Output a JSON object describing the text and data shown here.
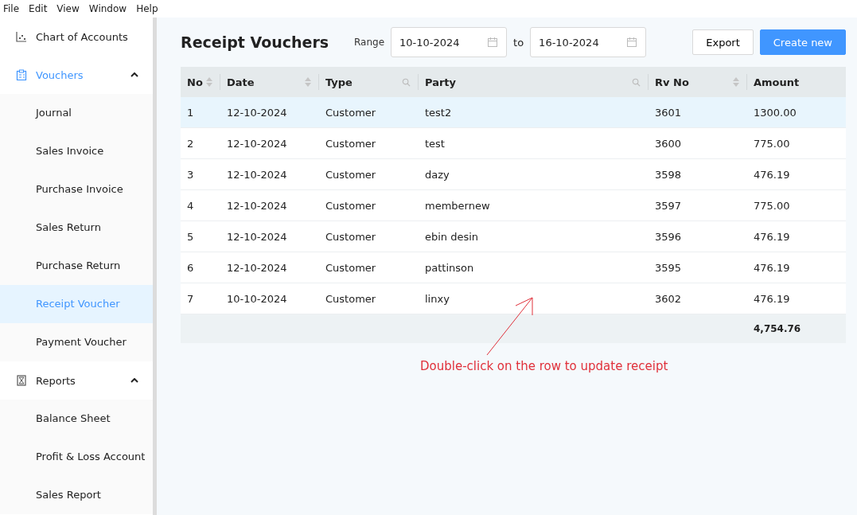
{
  "menu_bar": [
    "File",
    "Edit",
    "View",
    "Window",
    "Help"
  ],
  "sidebar": {
    "items": [
      {
        "label": "Chart of Accounts",
        "kind": "chart",
        "active": false
      },
      {
        "label": "Vouchers",
        "kind": "vouchers",
        "active": true,
        "expanded": true,
        "children": [
          {
            "label": "Journal",
            "selected": false
          },
          {
            "label": "Sales Invoice",
            "selected": false
          },
          {
            "label": "Purchase Invoice",
            "selected": false
          },
          {
            "label": "Sales Return",
            "selected": false
          },
          {
            "label": "Purchase Return",
            "selected": false
          },
          {
            "label": "Receipt Voucher",
            "selected": true
          },
          {
            "label": "Payment Voucher",
            "selected": false
          }
        ]
      },
      {
        "label": "Reports",
        "kind": "reports",
        "active": false,
        "expanded": true,
        "children": [
          {
            "label": "Balance Sheet",
            "selected": false
          },
          {
            "label": "Profit & Loss Account",
            "selected": false
          },
          {
            "label": "Sales Report",
            "selected": false
          }
        ]
      }
    ]
  },
  "page": {
    "title": "Receipt Vouchers",
    "range_label": "Range",
    "from_date": "10-10-2024",
    "to_label": "to",
    "to_date": "16-10-2024",
    "export_button": "Export",
    "create_button": "Create new"
  },
  "table": {
    "columns": [
      {
        "label": "No",
        "kind": "sortable"
      },
      {
        "label": "Date",
        "kind": "sortable"
      },
      {
        "label": "Type",
        "kind": "searchable"
      },
      {
        "label": "Party",
        "kind": "searchable"
      },
      {
        "label": "Rv No",
        "kind": "sortable"
      },
      {
        "label": "Amount",
        "kind": "plain"
      }
    ],
    "rows": [
      {
        "selected": true,
        "cells": [
          "1",
          "12-10-2024",
          "Customer",
          "test2",
          "3601",
          "1300.00"
        ]
      },
      {
        "selected": false,
        "cells": [
          "2",
          "12-10-2024",
          "Customer",
          "test",
          "3600",
          "775.00"
        ]
      },
      {
        "selected": false,
        "cells": [
          "3",
          "12-10-2024",
          "Customer",
          "dazy",
          "3598",
          "476.19"
        ]
      },
      {
        "selected": false,
        "cells": [
          "4",
          "12-10-2024",
          "Customer",
          "membernew",
          "3597",
          "775.00"
        ]
      },
      {
        "selected": false,
        "cells": [
          "5",
          "12-10-2024",
          "Customer",
          "ebin desin",
          "3596",
          "476.19"
        ]
      },
      {
        "selected": false,
        "cells": [
          "6",
          "12-10-2024",
          "Customer",
          "pattinson",
          "3595",
          "476.19"
        ]
      },
      {
        "selected": false,
        "cells": [
          "7",
          "10-10-2024",
          "Customer",
          "linxy",
          "3602",
          "476.19"
        ]
      }
    ],
    "total": "4,754.76"
  },
  "annotation": "Double-click on the row to update receipt"
}
